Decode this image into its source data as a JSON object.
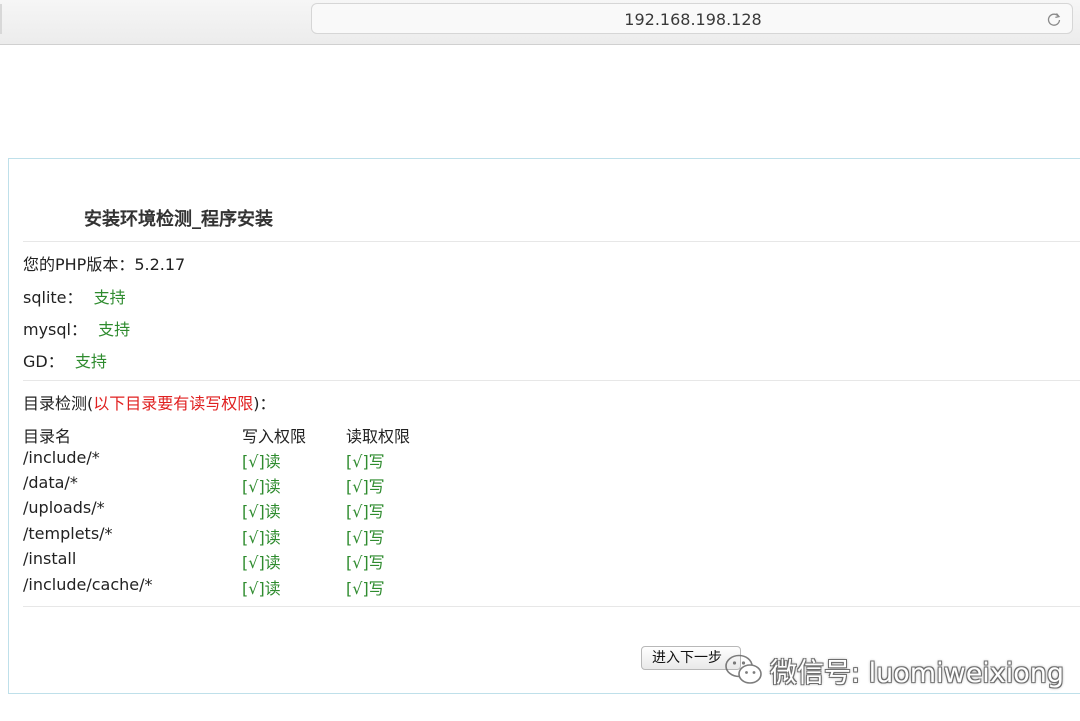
{
  "browser": {
    "address": "192.168.198.128"
  },
  "install": {
    "title": "安装环境检测_程序安装",
    "php": {
      "label": "您的PHP版本：",
      "value": "5.2.17"
    },
    "checks": [
      {
        "label": "sqlite：",
        "status": "支持"
      },
      {
        "label": "mysql：",
        "status": "支持"
      },
      {
        "label": "GD：",
        "status": "支持"
      }
    ],
    "dir_check": {
      "prefix": "目录检测(",
      "warning": "以下目录要有读写权限",
      "suffix": ")："
    },
    "table": {
      "headers": [
        "目录名",
        "写入权限",
        "读取权限"
      ],
      "rows": [
        {
          "dir": "/include/*",
          "write": "[√]读",
          "read": "[√]写"
        },
        {
          "dir": "/data/*",
          "write": "[√]读",
          "read": "[√]写"
        },
        {
          "dir": "/uploads/*",
          "write": "[√]读",
          "read": "[√]写"
        },
        {
          "dir": "/templets/*",
          "write": "[√]读",
          "read": "[√]写"
        },
        {
          "dir": "/install",
          "write": "[√]读",
          "read": "[√]写"
        },
        {
          "dir": "/include/cache/*",
          "write": "[√]读",
          "read": "[√]写"
        }
      ]
    },
    "next_button": "进入下一步"
  },
  "watermark": {
    "text": "微信号: luomiweixiong"
  },
  "colors": {
    "ok": "#2e8b2e",
    "warning": "#e02020",
    "panel_border": "#bfe0ea"
  }
}
